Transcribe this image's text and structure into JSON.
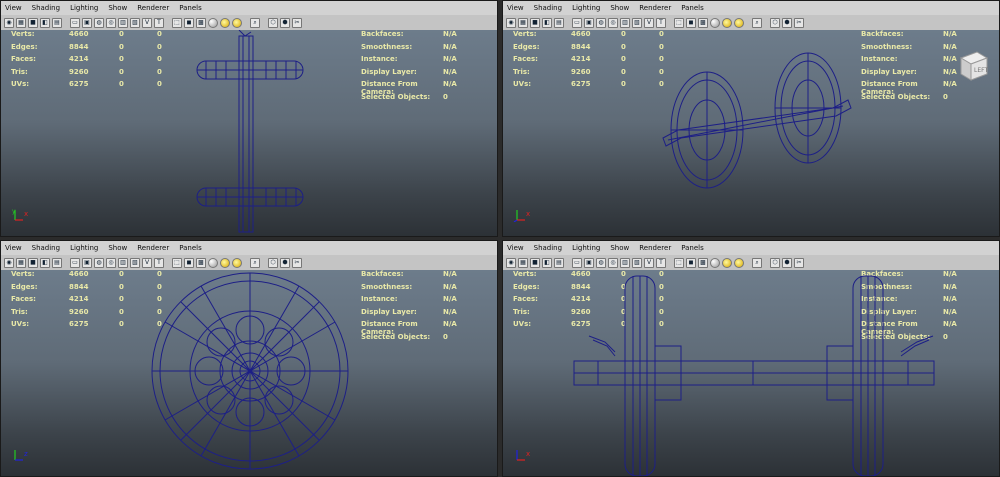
{
  "menu": [
    "View",
    "Shading",
    "Lighting",
    "Show",
    "Renderer",
    "Panels"
  ],
  "stats_left": [
    {
      "label": "Verts:",
      "v1": "4660",
      "v2": "0",
      "v3": "0"
    },
    {
      "label": "Edges:",
      "v1": "8844",
      "v2": "0",
      "v3": "0"
    },
    {
      "label": "Faces:",
      "v1": "4214",
      "v2": "0",
      "v3": "0"
    },
    {
      "label": "Tris:",
      "v1": "9260",
      "v2": "0",
      "v3": "0"
    },
    {
      "label": "UVs:",
      "v1": "6275",
      "v2": "0",
      "v3": "0"
    }
  ],
  "stats_right": [
    {
      "label": "Backfaces:",
      "value": "N/A"
    },
    {
      "label": "Smoothness:",
      "value": "N/A"
    },
    {
      "label": "Instance:",
      "value": "N/A"
    },
    {
      "label": "Display Layer:",
      "value": "N/A"
    },
    {
      "label": "Distance From Camera:",
      "value": "N/A"
    },
    {
      "label": "Selected Objects:",
      "value": "0"
    }
  ],
  "cube_label": "LEFT",
  "colors": {
    "wire": "#1d1f86",
    "hud": "#e9e9a8",
    "axis_x": "#d22",
    "axis_y": "#2c2",
    "axis_z": "#22d"
  }
}
